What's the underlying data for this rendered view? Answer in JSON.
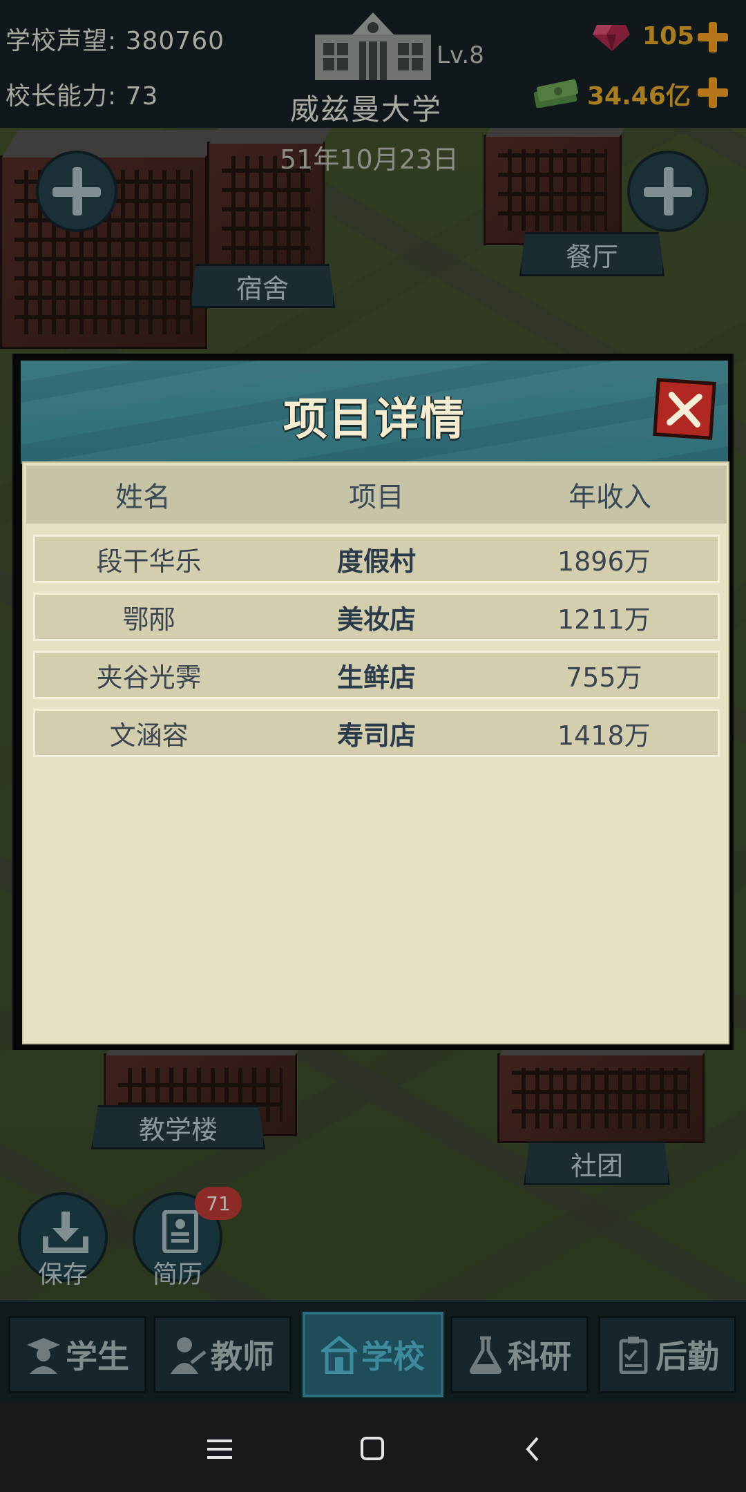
{
  "top_bar": {
    "reputation": "学校声望: 380760",
    "principal_ability": "校长能力: 73",
    "school_name": "威兹曼大学",
    "school_level": "Lv.8",
    "gems": "105",
    "money": "34.46亿"
  },
  "date": "51年10月23日",
  "map_labels": {
    "dorm": "宿舍",
    "canteen": "餐厅",
    "teaching_building": "教学楼",
    "club": "社团"
  },
  "actions": {
    "save": "保存",
    "resume": "简历",
    "resume_badge": "71"
  },
  "dialog": {
    "title": "项目详情",
    "columns": [
      "姓名",
      "项目",
      "年收入"
    ],
    "rows": [
      {
        "name": "段干华乐",
        "project": "度假村",
        "income": "1896万"
      },
      {
        "name": "鄂邴",
        "project": "美妆店",
        "income": "1211万"
      },
      {
        "name": "夹谷光霁",
        "project": "生鲜店",
        "income": "755万"
      },
      {
        "name": "文涵容",
        "project": "寿司店",
        "income": "1418万"
      }
    ]
  },
  "bottom_nav": {
    "student": "学生",
    "teacher": "教师",
    "school": "学校",
    "research": "科研",
    "logistics": "后勤",
    "active": "school"
  },
  "colors": {
    "dialog_header": "#2f6f78",
    "dialog_body": "#e4e2c2",
    "close_button": "#b02821",
    "active_tab": "#1e4c58",
    "resource_gold": "#a87d22"
  }
}
